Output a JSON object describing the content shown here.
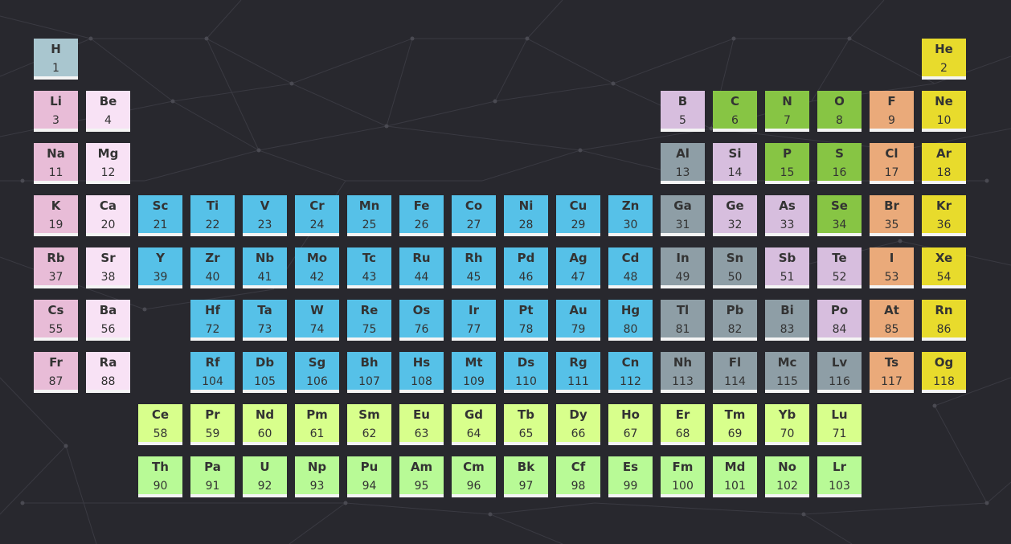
{
  "colors": {
    "hydrogen": "#a9c6cf",
    "alkali-metal": "#e8bcd7",
    "alkaline-earth-metal": "#f8e2f5",
    "transition-metal": "#56c1e8",
    "post-transition-metal": "#8e9ea6",
    "metalloid": "#d7bede",
    "reactive-nonmetal": "#87c544",
    "halogen": "#eaaa7a",
    "noble-gas": "#e8db2c",
    "lanthanide": "#d8ff8c",
    "actinide": "#b8fa96"
  },
  "elements": [
    {
      "symbol": "H",
      "number": "1",
      "category": "hydrogen"
    },
    {
      "symbol": "He",
      "number": "2",
      "category": "noble-gas"
    },
    {
      "symbol": "Li",
      "number": "3",
      "category": "alkali-metal"
    },
    {
      "symbol": "Be",
      "number": "4",
      "category": "alkaline-earth-metal"
    },
    {
      "symbol": "B",
      "number": "5",
      "category": "metalloid"
    },
    {
      "symbol": "C",
      "number": "6",
      "category": "reactive-nonmetal"
    },
    {
      "symbol": "N",
      "number": "7",
      "category": "reactive-nonmetal"
    },
    {
      "symbol": "O",
      "number": "8",
      "category": "reactive-nonmetal"
    },
    {
      "symbol": "F",
      "number": "9",
      "category": "halogen"
    },
    {
      "symbol": "Ne",
      "number": "10",
      "category": "noble-gas"
    },
    {
      "symbol": "Na",
      "number": "11",
      "category": "alkali-metal"
    },
    {
      "symbol": "Mg",
      "number": "12",
      "category": "alkaline-earth-metal"
    },
    {
      "symbol": "Al",
      "number": "13",
      "category": "post-transition-metal"
    },
    {
      "symbol": "Si",
      "number": "14",
      "category": "metalloid"
    },
    {
      "symbol": "P",
      "number": "15",
      "category": "reactive-nonmetal"
    },
    {
      "symbol": "S",
      "number": "16",
      "category": "reactive-nonmetal"
    },
    {
      "symbol": "Cl",
      "number": "17",
      "category": "halogen"
    },
    {
      "symbol": "Ar",
      "number": "18",
      "category": "noble-gas"
    },
    {
      "symbol": "K",
      "number": "19",
      "category": "alkali-metal"
    },
    {
      "symbol": "Ca",
      "number": "20",
      "category": "alkaline-earth-metal"
    },
    {
      "symbol": "Sc",
      "number": "21",
      "category": "transition-metal"
    },
    {
      "symbol": "Ti",
      "number": "22",
      "category": "transition-metal"
    },
    {
      "symbol": "V",
      "number": "23",
      "category": "transition-metal"
    },
    {
      "symbol": "Cr",
      "number": "24",
      "category": "transition-metal"
    },
    {
      "symbol": "Mn",
      "number": "25",
      "category": "transition-metal"
    },
    {
      "symbol": "Fe",
      "number": "26",
      "category": "transition-metal"
    },
    {
      "symbol": "Co",
      "number": "27",
      "category": "transition-metal"
    },
    {
      "symbol": "Ni",
      "number": "28",
      "category": "transition-metal"
    },
    {
      "symbol": "Cu",
      "number": "29",
      "category": "transition-metal"
    },
    {
      "symbol": "Zn",
      "number": "30",
      "category": "transition-metal"
    },
    {
      "symbol": "Ga",
      "number": "31",
      "category": "post-transition-metal"
    },
    {
      "symbol": "Ge",
      "number": "32",
      "category": "metalloid"
    },
    {
      "symbol": "As",
      "number": "33",
      "category": "metalloid"
    },
    {
      "symbol": "Se",
      "number": "34",
      "category": "reactive-nonmetal"
    },
    {
      "symbol": "Br",
      "number": "35",
      "category": "halogen"
    },
    {
      "symbol": "Kr",
      "number": "36",
      "category": "noble-gas"
    },
    {
      "symbol": "Rb",
      "number": "37",
      "category": "alkali-metal"
    },
    {
      "symbol": "Sr",
      "number": "38",
      "category": "alkaline-earth-metal"
    },
    {
      "symbol": "Y",
      "number": "39",
      "category": "transition-metal"
    },
    {
      "symbol": "Zr",
      "number": "40",
      "category": "transition-metal"
    },
    {
      "symbol": "Nb",
      "number": "41",
      "category": "transition-metal"
    },
    {
      "symbol": "Mo",
      "number": "42",
      "category": "transition-metal"
    },
    {
      "symbol": "Tc",
      "number": "43",
      "category": "transition-metal"
    },
    {
      "symbol": "Ru",
      "number": "44",
      "category": "transition-metal"
    },
    {
      "symbol": "Rh",
      "number": "45",
      "category": "transition-metal"
    },
    {
      "symbol": "Pd",
      "number": "46",
      "category": "transition-metal"
    },
    {
      "symbol": "Ag",
      "number": "47",
      "category": "transition-metal"
    },
    {
      "symbol": "Cd",
      "number": "48",
      "category": "transition-metal"
    },
    {
      "symbol": "In",
      "number": "49",
      "category": "post-transition-metal"
    },
    {
      "symbol": "Sn",
      "number": "50",
      "category": "post-transition-metal"
    },
    {
      "symbol": "Sb",
      "number": "51",
      "category": "metalloid"
    },
    {
      "symbol": "Te",
      "number": "52",
      "category": "metalloid"
    },
    {
      "symbol": "I",
      "number": "53",
      "category": "halogen"
    },
    {
      "symbol": "Xe",
      "number": "54",
      "category": "noble-gas"
    },
    {
      "symbol": "Cs",
      "number": "55",
      "category": "alkali-metal"
    },
    {
      "symbol": "Ba",
      "number": "56",
      "category": "alkaline-earth-metal"
    },
    {
      "symbol": "Ce",
      "number": "58",
      "category": "lanthanide"
    },
    {
      "symbol": "Pr",
      "number": "59",
      "category": "lanthanide"
    },
    {
      "symbol": "Nd",
      "number": "60",
      "category": "lanthanide"
    },
    {
      "symbol": "Pm",
      "number": "61",
      "category": "lanthanide"
    },
    {
      "symbol": "Sm",
      "number": "62",
      "category": "lanthanide"
    },
    {
      "symbol": "Eu",
      "number": "63",
      "category": "lanthanide"
    },
    {
      "symbol": "Gd",
      "number": "64",
      "category": "lanthanide"
    },
    {
      "symbol": "Tb",
      "number": "65",
      "category": "lanthanide"
    },
    {
      "symbol": "Dy",
      "number": "66",
      "category": "lanthanide"
    },
    {
      "symbol": "Ho",
      "number": "67",
      "category": "lanthanide"
    },
    {
      "symbol": "Er",
      "number": "68",
      "category": "lanthanide"
    },
    {
      "symbol": "Tm",
      "number": "69",
      "category": "lanthanide"
    },
    {
      "symbol": "Yb",
      "number": "70",
      "category": "lanthanide"
    },
    {
      "symbol": "Lu",
      "number": "71",
      "category": "lanthanide"
    },
    {
      "symbol": "Hf",
      "number": "72",
      "category": "transition-metal"
    },
    {
      "symbol": "Ta",
      "number": "73",
      "category": "transition-metal"
    },
    {
      "symbol": "W",
      "number": "74",
      "category": "transition-metal"
    },
    {
      "symbol": "Re",
      "number": "75",
      "category": "transition-metal"
    },
    {
      "symbol": "Os",
      "number": "76",
      "category": "transition-metal"
    },
    {
      "symbol": "Ir",
      "number": "77",
      "category": "transition-metal"
    },
    {
      "symbol": "Pt",
      "number": "78",
      "category": "transition-metal"
    },
    {
      "symbol": "Au",
      "number": "79",
      "category": "transition-metal"
    },
    {
      "symbol": "Hg",
      "number": "80",
      "category": "transition-metal"
    },
    {
      "symbol": "Tl",
      "number": "81",
      "category": "post-transition-metal"
    },
    {
      "symbol": "Pb",
      "number": "82",
      "category": "post-transition-metal"
    },
    {
      "symbol": "Bi",
      "number": "83",
      "category": "post-transition-metal"
    },
    {
      "symbol": "Po",
      "number": "84",
      "category": "metalloid"
    },
    {
      "symbol": "At",
      "number": "85",
      "category": "halogen"
    },
    {
      "symbol": "Rn",
      "number": "86",
      "category": "noble-gas"
    },
    {
      "symbol": "Fr",
      "number": "87",
      "category": "alkali-metal"
    },
    {
      "symbol": "Ra",
      "number": "88",
      "category": "alkaline-earth-metal"
    },
    {
      "symbol": "Th",
      "number": "90",
      "category": "actinide"
    },
    {
      "symbol": "Pa",
      "number": "91",
      "category": "actinide"
    },
    {
      "symbol": "U",
      "number": "92",
      "category": "actinide"
    },
    {
      "symbol": "Np",
      "number": "93",
      "category": "actinide"
    },
    {
      "symbol": "Pu",
      "number": "94",
      "category": "actinide"
    },
    {
      "symbol": "Am",
      "number": "95",
      "category": "actinide"
    },
    {
      "symbol": "Cm",
      "number": "96",
      "category": "actinide"
    },
    {
      "symbol": "Bk",
      "number": "97",
      "category": "actinide"
    },
    {
      "symbol": "Cf",
      "number": "98",
      "category": "actinide"
    },
    {
      "symbol": "Es",
      "number": "99",
      "category": "actinide"
    },
    {
      "symbol": "Fm",
      "number": "100",
      "category": "actinide"
    },
    {
      "symbol": "Md",
      "number": "101",
      "category": "actinide"
    },
    {
      "symbol": "No",
      "number": "102",
      "category": "actinide"
    },
    {
      "symbol": "Lr",
      "number": "103",
      "category": "actinide"
    },
    {
      "symbol": "Rf",
      "number": "104",
      "category": "transition-metal"
    },
    {
      "symbol": "Db",
      "number": "105",
      "category": "transition-metal"
    },
    {
      "symbol": "Sg",
      "number": "106",
      "category": "transition-metal"
    },
    {
      "symbol": "Bh",
      "number": "107",
      "category": "transition-metal"
    },
    {
      "symbol": "Hs",
      "number": "108",
      "category": "transition-metal"
    },
    {
      "symbol": "Mt",
      "number": "109",
      "category": "transition-metal"
    },
    {
      "symbol": "Ds",
      "number": "110",
      "category": "transition-metal"
    },
    {
      "symbol": "Rg",
      "number": "111",
      "category": "transition-metal"
    },
    {
      "symbol": "Cn",
      "number": "112",
      "category": "transition-metal"
    },
    {
      "symbol": "Nh",
      "number": "113",
      "category": "post-transition-metal"
    },
    {
      "symbol": "Fl",
      "number": "114",
      "category": "post-transition-metal"
    },
    {
      "symbol": "Mc",
      "number": "115",
      "category": "post-transition-metal"
    },
    {
      "symbol": "Lv",
      "number": "116",
      "category": "post-transition-metal"
    },
    {
      "symbol": "Ts",
      "number": "117",
      "category": "halogen"
    },
    {
      "symbol": "Og",
      "number": "118",
      "category": "noble-gas"
    }
  ]
}
